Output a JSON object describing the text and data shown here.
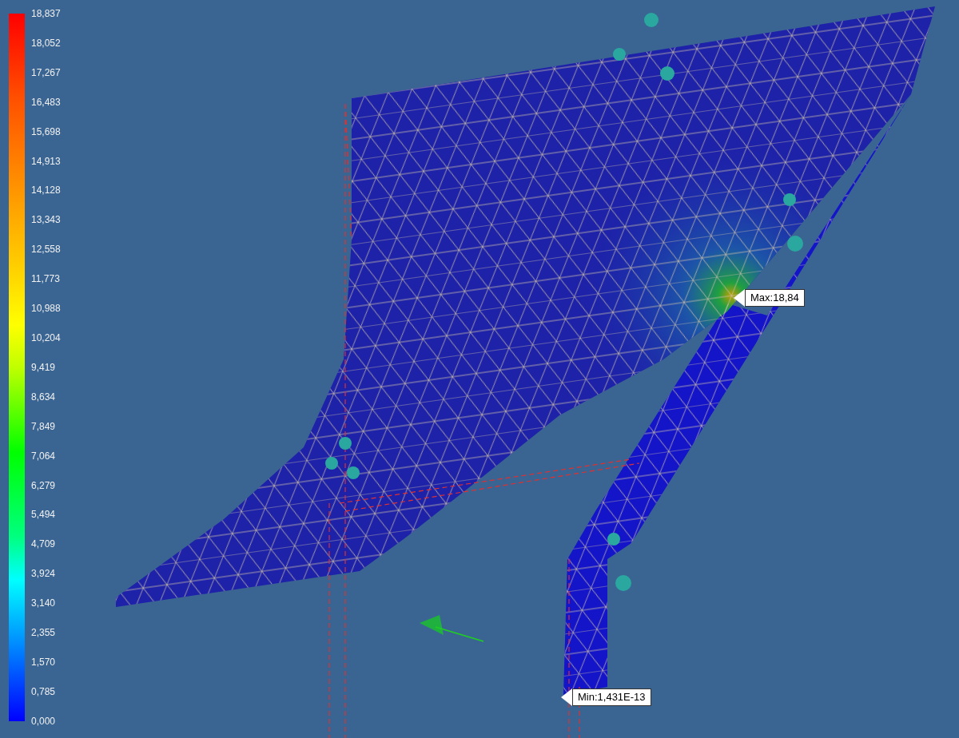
{
  "legend": {
    "labels": [
      "18,837",
      "18,052",
      "17,267",
      "16,483",
      "15,698",
      "14,913",
      "14,128",
      "13,343",
      "12,558",
      "11,773",
      "10,988",
      "10,204",
      "9,419",
      "8,634",
      "7,849",
      "7,064",
      "6,279",
      "5,494",
      "4,709",
      "3,924",
      "3,140",
      "2,355",
      "1,570",
      "0,785",
      "0,000"
    ]
  },
  "callouts": [
    {
      "kind": "max",
      "text": "Max:18,84"
    },
    {
      "kind": "min",
      "text": "Min:1,431E-13"
    }
  ]
}
